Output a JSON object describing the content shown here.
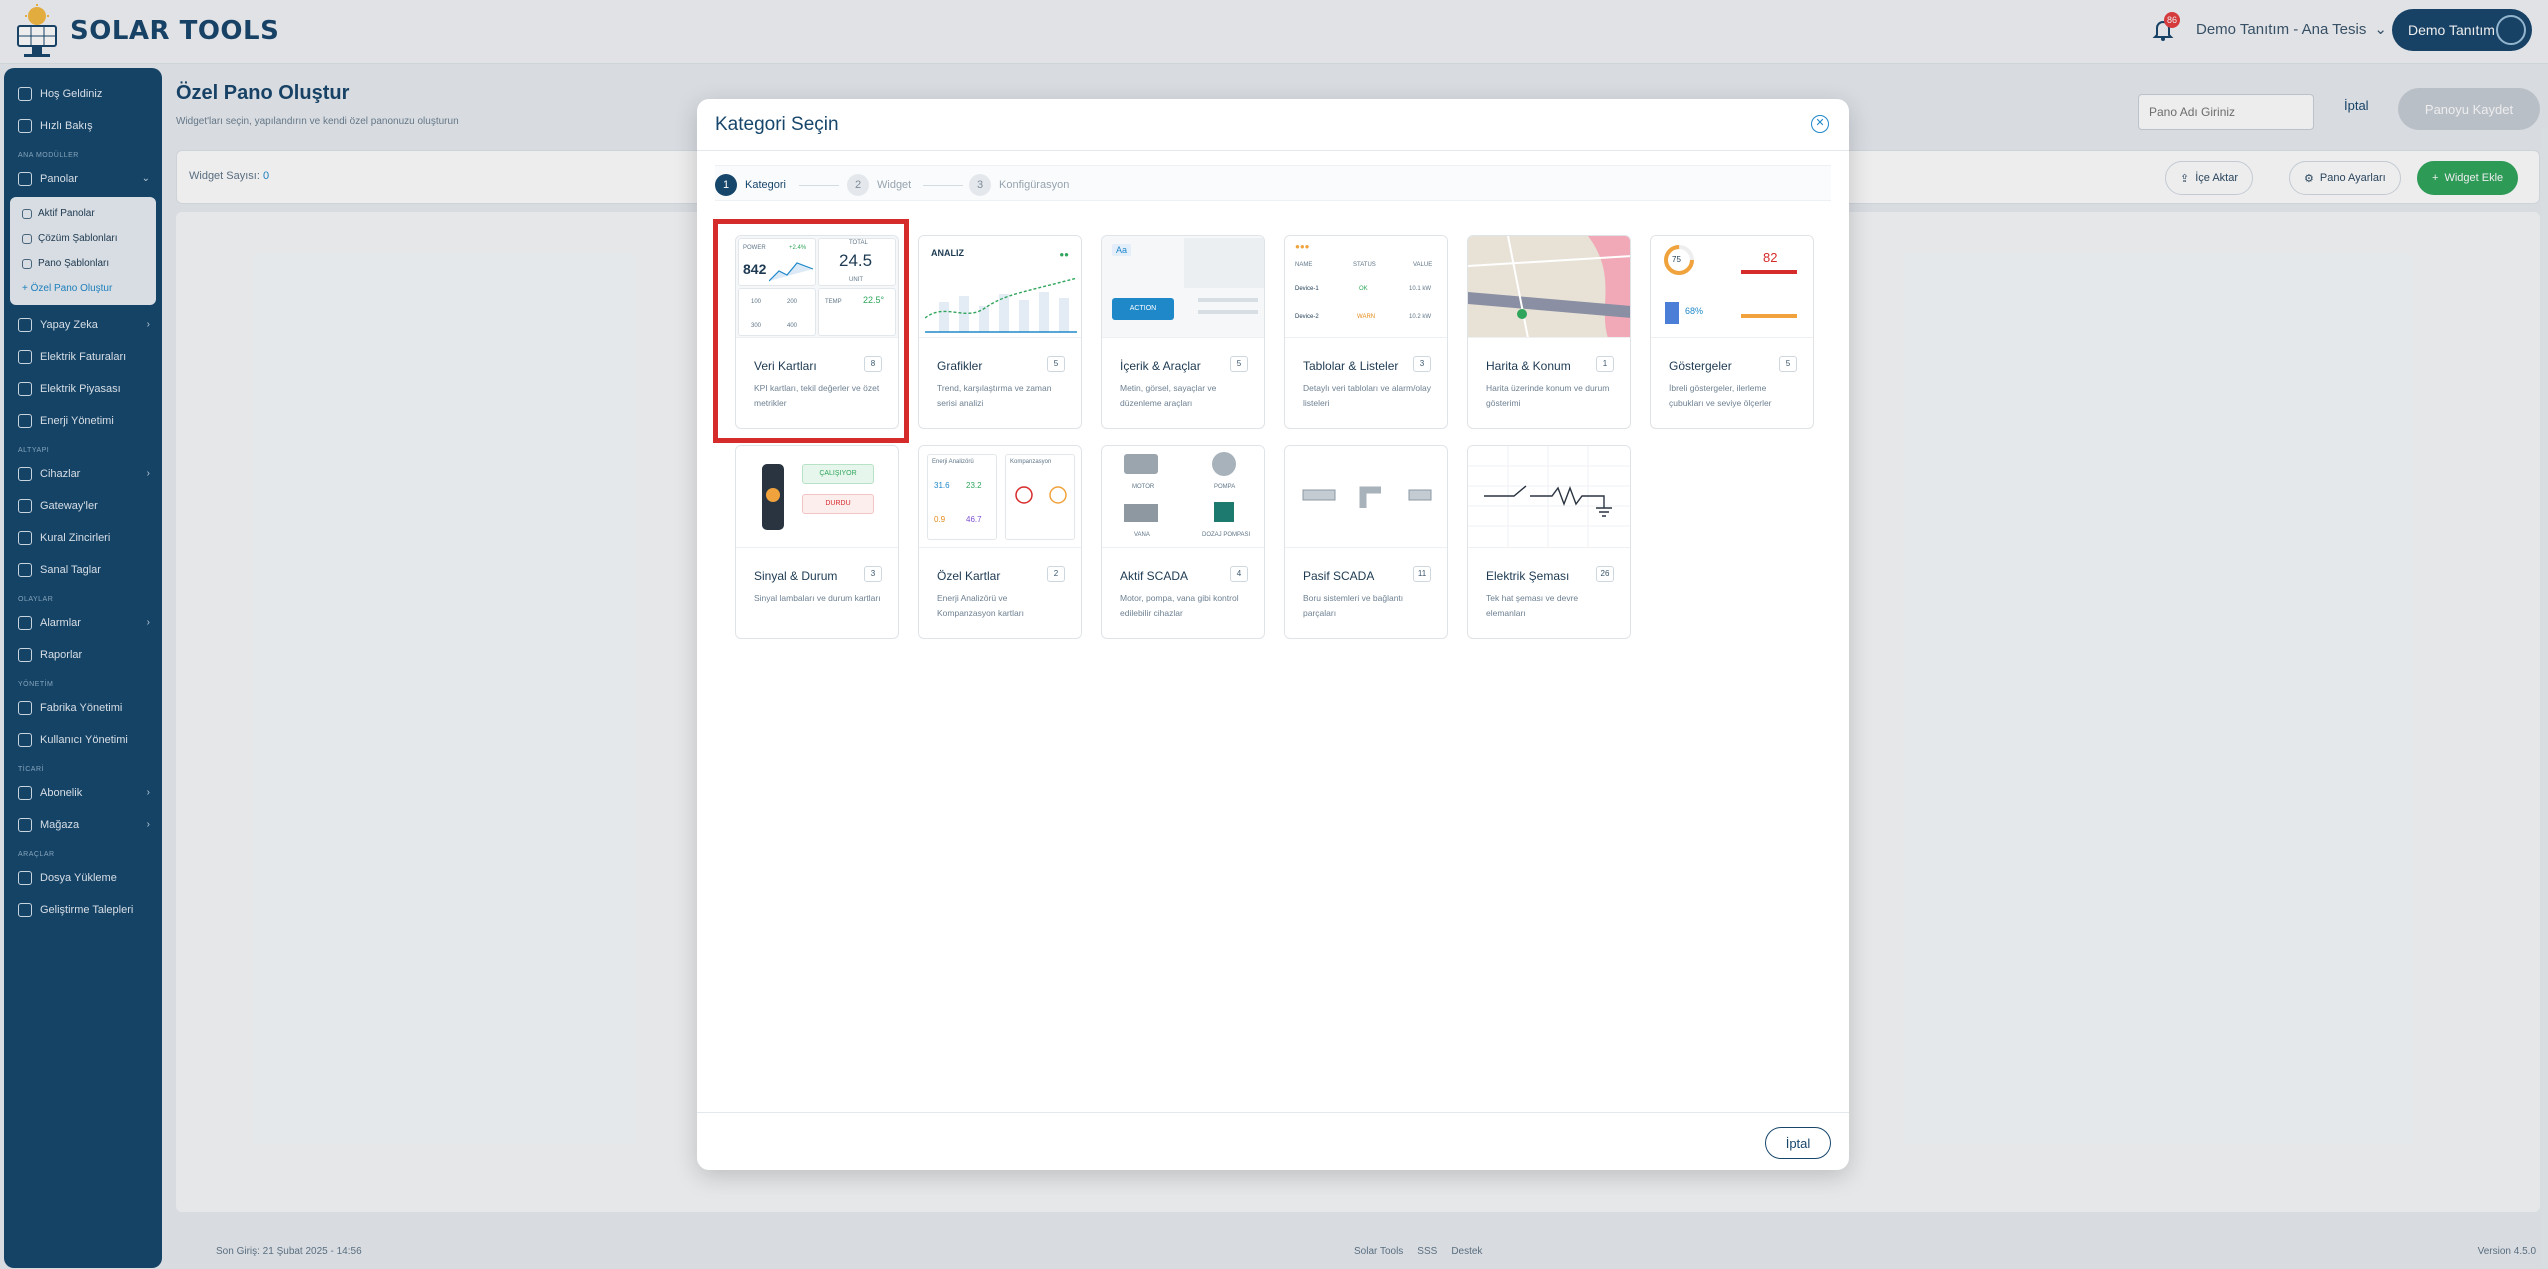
{
  "app": {
    "name": "SOLAR TOOLS",
    "notif_count": "86",
    "tenant": "Demo Tanıtım - Ana Tesis",
    "user": "Demo Tanıtım"
  },
  "sidebar": {
    "items": [
      {
        "label": "Hoş Geldiniz"
      },
      {
        "label": "Hızlı Bakış"
      }
    ],
    "section_main": "ANA MODÜLLER",
    "panolar": "Panolar",
    "panolar_sub": [
      "Aktif Panolar",
      "Çözüm Şablonları",
      "Pano Şablonları",
      "+ Özel Pano Oluştur"
    ],
    "main_items": [
      "Yapay Zeka",
      "Elektrik Faturaları",
      "Elektrik Piyasası",
      "Enerji Yönetimi"
    ],
    "section_infra": "ALTYAPI",
    "infra_items": [
      "Cihazlar",
      "Gateway'ler",
      "Kural Zincirleri",
      "Sanal Taglar"
    ],
    "section_alarm": "OLAYLAR",
    "alarm_items": [
      "Alarmlar",
      "Raporlar"
    ],
    "section_admin": "YÖNETİM",
    "admin_items": [
      "Fabrika Yönetimi",
      "Kullanıcı Yönetimi"
    ],
    "section_commerce": "TİCARİ",
    "commerce_items": [
      "Abonelik",
      "Mağaza"
    ],
    "section_tools": "ARAÇLAR",
    "tools_items": [
      "Dosya Yükleme",
      "Geliştirme Talepleri"
    ]
  },
  "page": {
    "title": "Özel Pano Oluştur",
    "subtitle": "Widget'ları seçin, yapılandırın ve kendi özel panonuzu oluşturun",
    "name_placeholder": "Pano Adı Giriniz",
    "cancel": "İptal",
    "save": "Panoyu Kaydet",
    "widget_count_label": "Widget Sayısı:",
    "widget_count": "0",
    "import": "İçe Aktar",
    "settings": "Pano Ayarları",
    "add_widget": "Widget Ekle"
  },
  "modal": {
    "title": "Kategori Seçin",
    "steps": [
      {
        "num": "1",
        "label": "Kategori"
      },
      {
        "num": "2",
        "label": "Widget"
      },
      {
        "num": "3",
        "label": "Konfigürasyon"
      }
    ],
    "categories": [
      {
        "name": "Veri Kartları",
        "count": "8",
        "desc": "KPI kartları, tekil değerler ve özet metrikler"
      },
      {
        "name": "Grafikler",
        "count": "5",
        "desc": "Trend, karşılaştırma ve zaman serisi analizi"
      },
      {
        "name": "İçerik & Araçlar",
        "count": "5",
        "desc": "Metin, görsel, sayaçlar ve düzenleme araçları"
      },
      {
        "name": "Tablolar & Listeler",
        "count": "3",
        "desc": "Detaylı veri tabloları ve alarm/olay listeleri"
      },
      {
        "name": "Harita & Konum",
        "count": "1",
        "desc": "Harita üzerinde konum ve durum gösterimi"
      },
      {
        "name": "Göstergeler",
        "count": "5",
        "desc": "İbreli göstergeler, ilerleme çubukları ve seviye ölçerler"
      },
      {
        "name": "Sinyal & Durum",
        "count": "3",
        "desc": "Sinyal lambaları ve durum kartları"
      },
      {
        "name": "Özel Kartlar",
        "count": "2",
        "desc": "Enerji Analizörü ve Kompanzasyon kartları"
      },
      {
        "name": "Aktif SCADA",
        "count": "4",
        "desc": "Motor, pompa, vana gibi kontrol edilebilir cihazlar"
      },
      {
        "name": "Pasif SCADA",
        "count": "11",
        "desc": "Boru sistemleri ve bağlantı parçaları"
      },
      {
        "name": "Elektrik Şeması",
        "count": "26",
        "desc": "Tek hat şeması ve devre elemanları"
      }
    ],
    "preview": {
      "kpi_power": "POWER",
      "kpi_power_val": "842",
      "kpi_delta": "+2.4%",
      "kpi_total": "TOTAL",
      "kpi_total_val": "24.5",
      "kpi_unit": "UNIT",
      "kpi_a1": "100",
      "kpi_a2": "200",
      "kpi_a3": "300",
      "kpi_a4": "400",
      "kpi_temp": "TEMP",
      "kpi_temp_val": "22.5°",
      "chart_title": "ANALIZ",
      "aa": "Aa",
      "action": "ACTION",
      "tbl_h1": "NAME",
      "tbl_h2": "STATUS",
      "tbl_h3": "VALUE",
      "tbl_r1": "Device-1",
      "tbl_s1": "OK",
      "tbl_v1": "10.1 kW",
      "tbl_r2": "Device-2",
      "tbl_s2": "WARN",
      "tbl_v2": "10.2 kW",
      "gauge_val": "75",
      "gauge_big": "82",
      "gauge_pct": "68%",
      "sig_on": "ÇALIŞIYOR",
      "sig_off": "DURDU",
      "ea_title": "Enerji Analizörü",
      "comp_title": "Kompanzasyon",
      "ea_v1": "31.6",
      "ea_v2": "23.2",
      "ea_v3": "0.9",
      "ea_v4": "46.7",
      "scada_motor": "MOTOR",
      "scada_pump": "POMPA",
      "scada_valve": "VANA",
      "scada_dosing": "DOZAJ POMPASI"
    },
    "cancel": "İptal"
  },
  "footer": {
    "last_login": "Son Giriş: 21 Şubat 2025 - 14:56",
    "links": [
      "Solar Tools",
      "SSS",
      "Destek"
    ],
    "version": "Version 4.5.0"
  },
  "colors": {
    "brand": "#17466b",
    "accent": "#1e88c9",
    "success": "#2fa55b",
    "highlight": "#d62b2b"
  }
}
